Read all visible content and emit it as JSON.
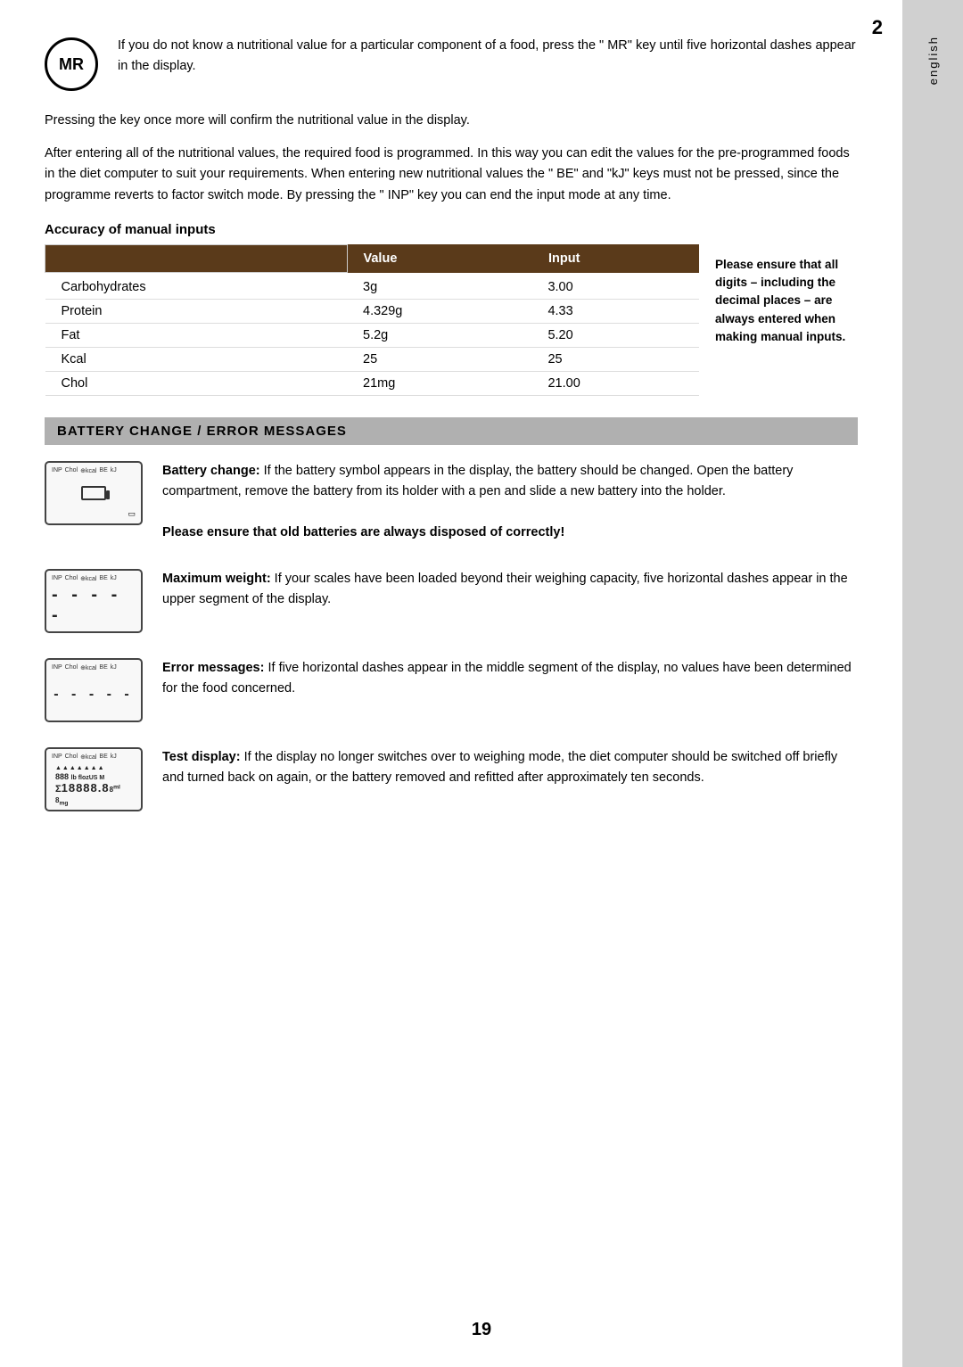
{
  "page": {
    "number_top": "2",
    "number_bottom": "19",
    "side_tab_label": "english"
  },
  "intro": {
    "mr_label": "MR",
    "paragraph1": "If you do not know a nutritional value for a particular component of a food, press the \" MR\" key until five horizontal dashes appear in the display.",
    "paragraph2": "Pressing the key once more will confirm the nutritional value in the display.",
    "paragraph3": "After entering all of the nutritional values, the required food is programmed. In this way you can edit the values for the pre-programmed foods in the diet computer to suit your requirements. When entering new nutritional values the \" BE\" and \"kJ\" keys must not be pressed, since the programme reverts to factor switch mode. By pressing the \" INP\" key you can end the input mode at any time."
  },
  "accuracy": {
    "heading": "Accuracy of manual inputs",
    "table": {
      "col1_header": "",
      "col2_header": "Value",
      "col3_header": "Input",
      "rows": [
        {
          "label": "Carbohydrates",
          "value": "3g",
          "input": "3.00"
        },
        {
          "label": "Protein",
          "value": "4.329g",
          "input": "4.33"
        },
        {
          "label": "Fat",
          "value": "5.2g",
          "input": "5.20"
        },
        {
          "label": "Kcal",
          "value": "25",
          "input": "25"
        },
        {
          "label": "Chol",
          "value": "21mg",
          "input": "21.00"
        }
      ]
    },
    "side_note": "Please ensure that all digits – including the decimal places – are always entered when making manual inputs."
  },
  "battery": {
    "heading": "BATTERY CHANGE / ERROR MESSAGES",
    "item1": {
      "text_bold": "Battery change:",
      "text": " If the battery symbol appears in the display, the battery should be changed. Open the battery compartment, remove the battery from its holder with a pen and slide a new battery into the holder.",
      "bold_line": "Please ensure that old batteries are always disposed of correctly!"
    },
    "item2": {
      "text_bold": "Maximum weight:",
      "text": " If your scales have been loaded beyond their weighing capacity, five horizontal dashes appear in the upper segment of the display."
    },
    "item3": {
      "text_bold": "Error messages:",
      "text": " If five horizontal dashes appear in the middle segment of the display, no values have been determined for the food concerned."
    },
    "item4": {
      "text_bold": "Test display:",
      "text": " If the display no longer switches over to weighing mode, the diet computer should be switched off briefly and turned back on again, or the battery removed and refitted after approximately ten seconds."
    }
  }
}
